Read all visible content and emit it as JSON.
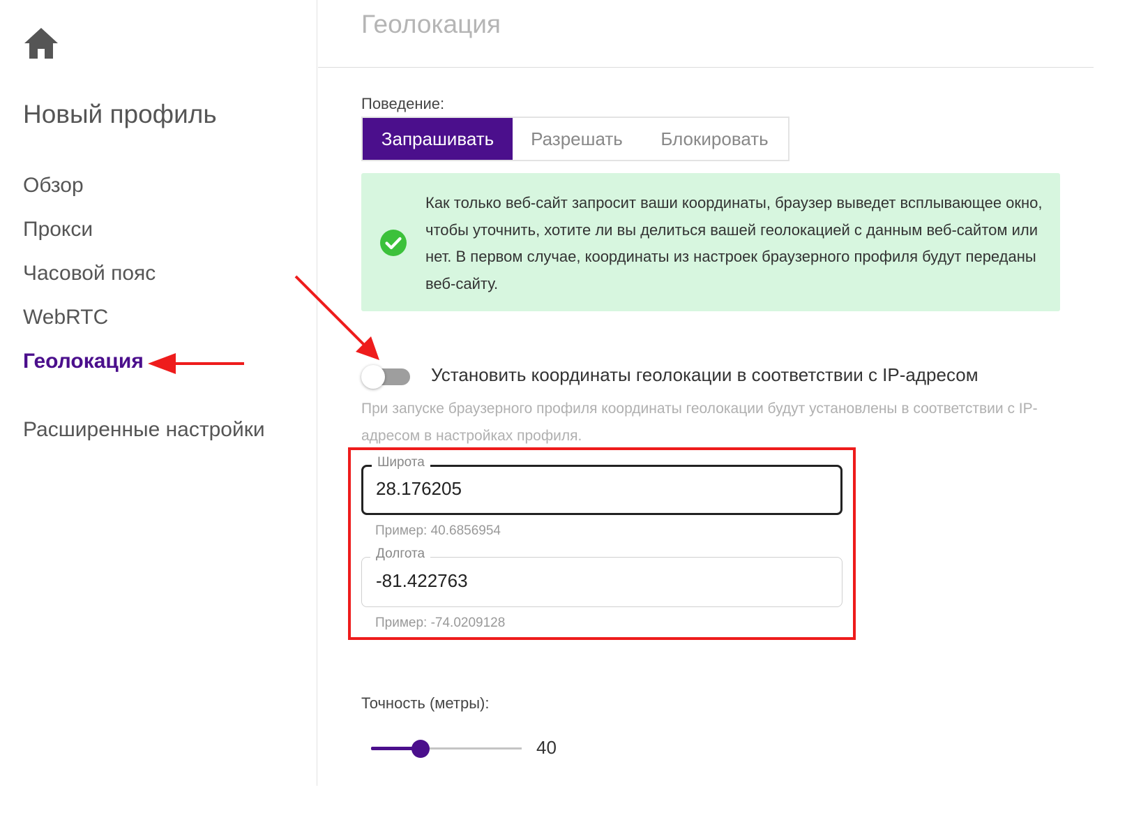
{
  "sidebar": {
    "profile_title": "Новый профиль",
    "items": [
      {
        "label": "Обзор"
      },
      {
        "label": "Прокси"
      },
      {
        "label": "Часовой пояс"
      },
      {
        "label": "WebRTC"
      },
      {
        "label": "Геолокация"
      }
    ],
    "active_item": "Геолокация",
    "advanced_label": "Расширенные настройки"
  },
  "header": {
    "title": "Геолокация"
  },
  "behavior": {
    "label": "Поведение:",
    "options": [
      "Запрашивать",
      "Разрешать",
      "Блокировать"
    ],
    "selected": "Запрашивать"
  },
  "info": {
    "text": "Как только веб-сайт запросит ваши координаты, браузер выведет всплывающее окно, чтобы уточнить, хотите ли вы делиться вашей геолокацией с данным веб-сайтом или нет. В первом случае, координаты из настроек браузерного профиля будут переданы веб-сайту."
  },
  "ip_toggle": {
    "label": "Установить координаты геолокации в соответствии с IP-адресом",
    "help": "При запуске браузерного профиля координаты геолокации будут установлены в соответствии с IP-адресом в настройках профиля.",
    "enabled": false
  },
  "latitude": {
    "label": "Широта",
    "value": "28.176205",
    "example": "Пример: 40.6856954"
  },
  "longitude": {
    "label": "Долгота",
    "value": "-81.422763",
    "example": "Пример: -74.0209128"
  },
  "accuracy": {
    "label": "Точность (метры):",
    "value": "40",
    "slider_fraction": 0.33
  },
  "colors": {
    "accent": "#4b0f8c",
    "info_bg": "#d7f6df",
    "success": "#3cc13b",
    "annotation_red": "#ee1c1c"
  }
}
